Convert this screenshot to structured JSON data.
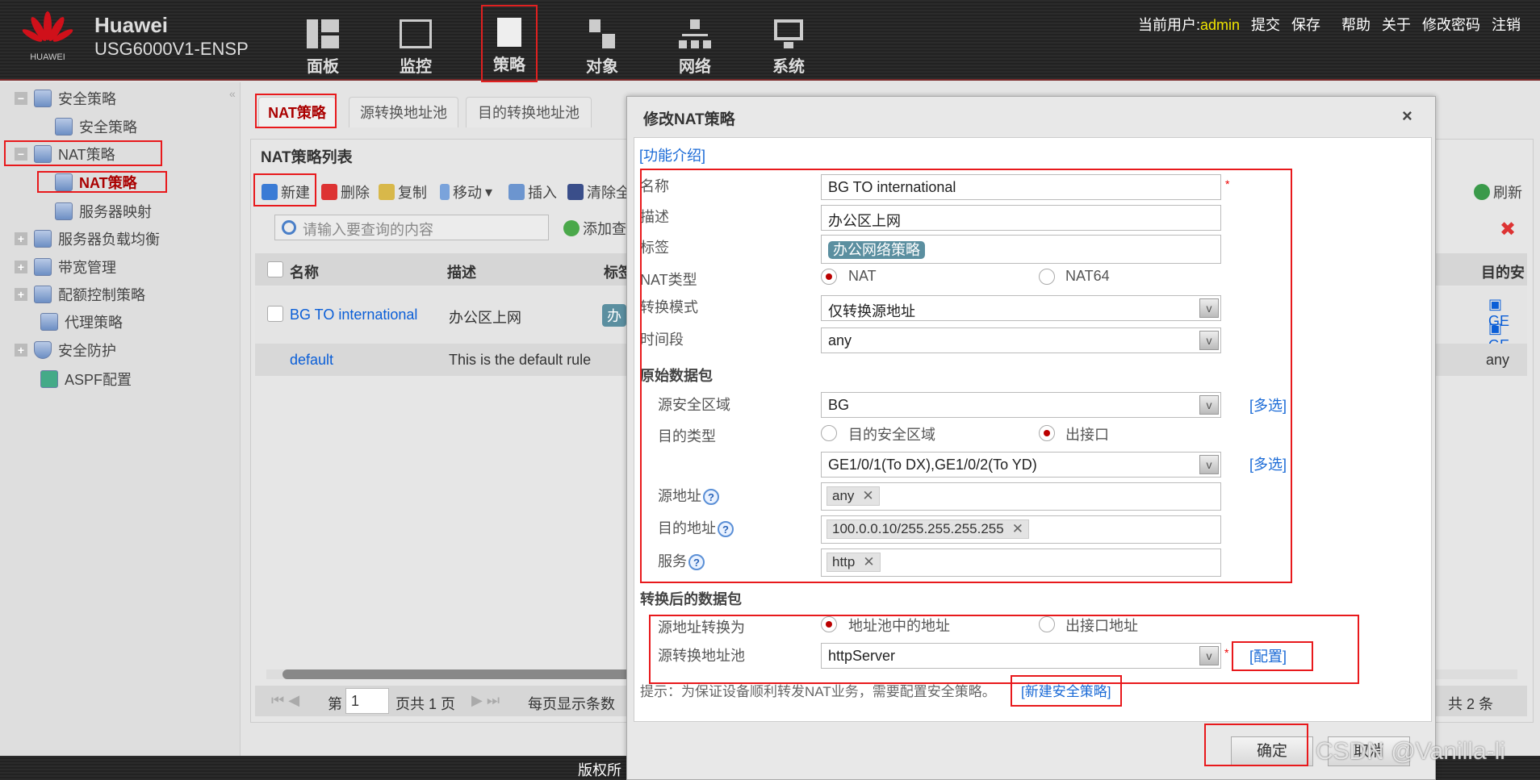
{
  "header": {
    "brand": "Huawei",
    "logo_text": "HUAWEI",
    "device": "USG6000V1-ENSP",
    "nav": [
      {
        "label": "面板",
        "icon": "dashboard-icon"
      },
      {
        "label": "监控",
        "icon": "monitor-icon"
      },
      {
        "label": "策略",
        "icon": "policy-icon",
        "selected": true
      },
      {
        "label": "对象",
        "icon": "object-icon"
      },
      {
        "label": "网络",
        "icon": "network-icon"
      },
      {
        "label": "系统",
        "icon": "system-icon"
      }
    ],
    "user_label": "当前用户:",
    "user": "admin",
    "links": [
      "提交",
      "保存",
      "帮助",
      "关于",
      "修改密码",
      "注销"
    ]
  },
  "sidebar": {
    "items": [
      {
        "label": "安全策略",
        "expand": "−"
      },
      {
        "label": "安全策略"
      },
      {
        "label": "NAT策略",
        "expand": "−"
      },
      {
        "label": "NAT策略",
        "selected": true
      },
      {
        "label": "服务器映射"
      },
      {
        "label": "服务器负载均衡",
        "expand": "+"
      },
      {
        "label": "带宽管理",
        "expand": "+"
      },
      {
        "label": "配额控制策略",
        "expand": "+"
      },
      {
        "label": "代理策略"
      },
      {
        "label": "安全防护",
        "expand": "+"
      },
      {
        "label": "ASPF配置"
      }
    ]
  },
  "tabs": [
    "NAT策略",
    "源转换地址池",
    "目的转换地址池"
  ],
  "panel": {
    "title": "NAT策略列表",
    "toolbar": [
      "新建",
      "删除",
      "复制",
      "移动",
      "插入",
      "清除全"
    ],
    "refresh": "刷新",
    "search_placeholder": "请输入要查询的内容",
    "add_query": "添加查",
    "columns": [
      "名称",
      "描述",
      "标签",
      "目的安"
    ],
    "rows": [
      {
        "name": "BG TO international",
        "desc": "办公区上网",
        "tag": "办",
        "dest": [
          "GE",
          "GE"
        ]
      },
      {
        "name": "default",
        "desc": "This is the default rule",
        "dest": [
          "any"
        ]
      }
    ],
    "pager": {
      "page_prefix": "第",
      "page": "1",
      "page_suffix": "页共 1 页",
      "per_page": "每页显示条数",
      "total": "共 2 条"
    }
  },
  "dialog": {
    "title": "修改NAT策略",
    "close": "×",
    "intro": "[功能介绍]",
    "name_label": "名称",
    "name": "BG TO international",
    "desc_label": "描述",
    "desc": "办公区上网",
    "tag_label": "标签",
    "tag": "办公网络策略",
    "tag_color": "#5b8fa0",
    "nat_type_label": "NAT类型",
    "nat_type_options": [
      "NAT",
      "NAT64"
    ],
    "nat_type": "NAT",
    "mode_label": "转换模式",
    "mode": "仅转换源地址",
    "time_label": "时间段",
    "time": "any",
    "orig_section": "原始数据包",
    "src_zone_label": "源安全区域",
    "src_zone": "BG",
    "multi": "[多选]",
    "dst_type_label": "目的类型",
    "dst_type_options": [
      "目的安全区域",
      "出接口"
    ],
    "dst_type": "出接口",
    "out_if": "GE1/0/1(To DX),GE1/0/2(To YD)",
    "src_addr_label": "源地址",
    "src_addr": "any",
    "dst_addr_label": "目的地址",
    "dst_addr": "100.0.0.10/255.255.255.255",
    "service_label": "服务",
    "service": "http",
    "trans_section": "转换后的数据包",
    "src_trans_label": "源地址转换为",
    "src_trans_options": [
      "地址池中的地址",
      "出接口地址"
    ],
    "src_trans": "地址池中的地址",
    "pool_label": "源转换地址池",
    "pool": "httpServer",
    "config": "[配置]",
    "hint": "提示：为保证设备顺利转发NAT业务，需要配置安全策略。",
    "hint_link": "[新建安全策略]",
    "ok": "确定",
    "cancel": "取消"
  },
  "footer": {
    "copyright": "版权所"
  },
  "watermark": "CSDN @Vanilla-li",
  "colors": {
    "accent_red": "#e8191c",
    "link": "#0a5ed7",
    "user": "#f0e500"
  }
}
